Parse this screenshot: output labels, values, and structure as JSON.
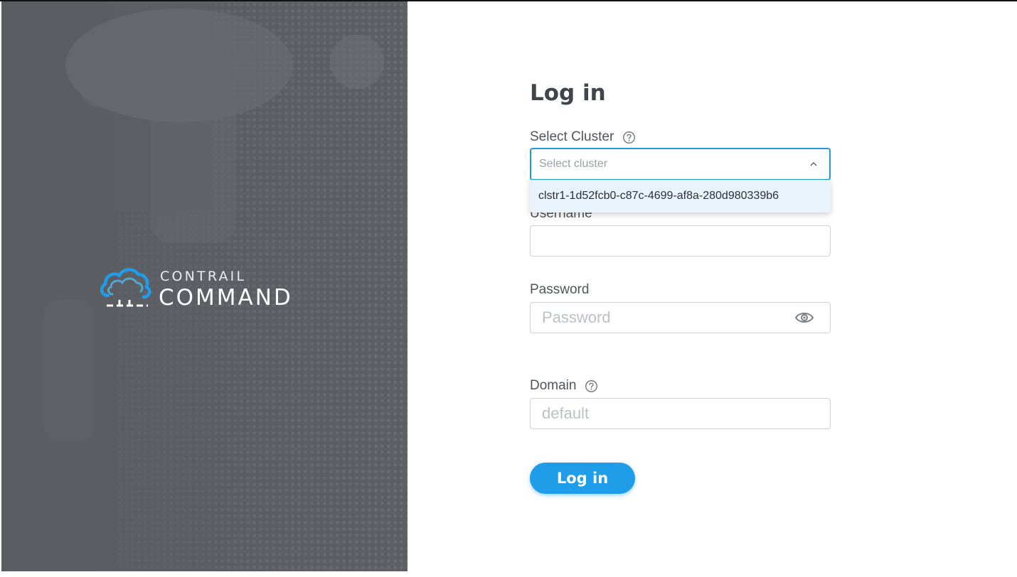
{
  "brand": {
    "line1": "CONTRAIL",
    "line2": "COMMAND",
    "accent_color": "#1f9de8"
  },
  "form": {
    "title": "Log in",
    "cluster": {
      "label": "Select Cluster",
      "placeholder": "Select cluster",
      "options": [
        "clstr1-1d52fcb0-c87c-4699-af8a-280d980339b6"
      ]
    },
    "username": {
      "label": "Username",
      "value": ""
    },
    "password": {
      "label": "Password",
      "placeholder": "Password"
    },
    "domain": {
      "label": "Domain",
      "placeholder": "default"
    },
    "submit_label": "Log in"
  },
  "icons": {
    "cluster_help": "question-circle-icon",
    "domain_help": "question-circle-icon",
    "password_toggle": "eye-icon",
    "select_toggle": "chevron-up-icon",
    "logo": "cloud-network-icon"
  }
}
